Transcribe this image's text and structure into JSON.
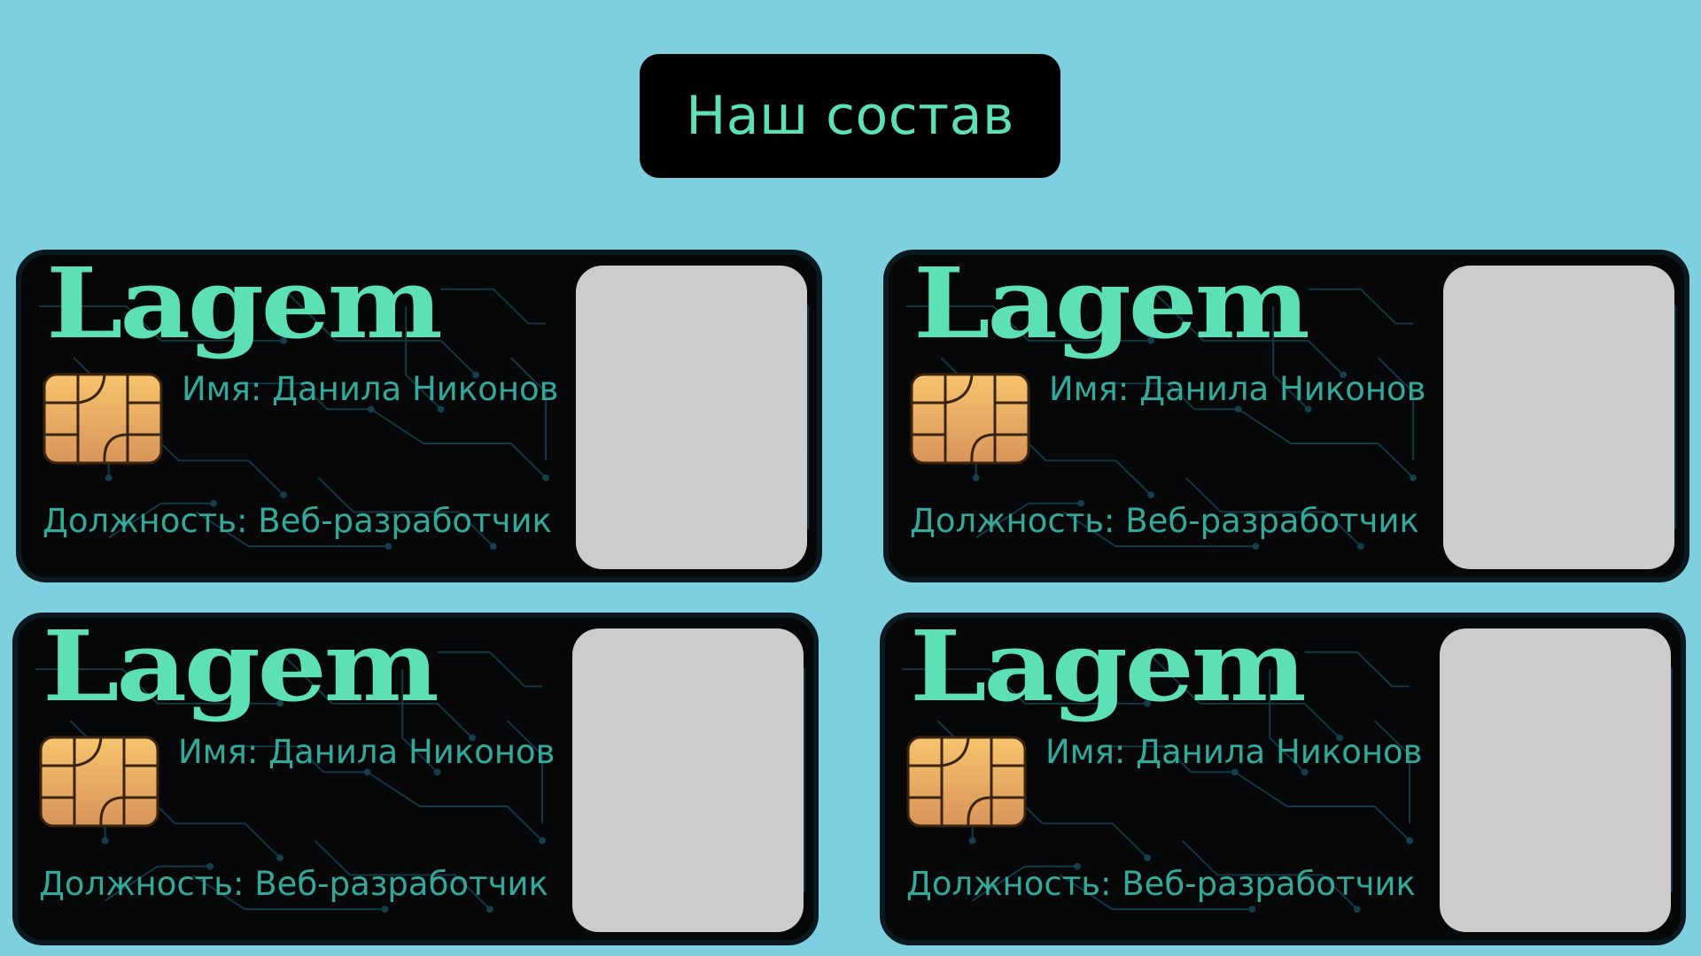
{
  "header": {
    "title": "Наш состав"
  },
  "cards": [
    {
      "logo": "Lagem",
      "chip_icon": "sim-chip-icon",
      "name": "Имя: Данила Никонов",
      "role": "Должность: Веб-разработчик"
    },
    {
      "logo": "Lagem",
      "chip_icon": "sim-chip-icon",
      "name": "Имя: Данила Никонов",
      "role": "Должность: Веб-разработчик"
    },
    {
      "logo": "Lagem",
      "chip_icon": "sim-chip-icon",
      "name": "Имя: Данила Никонов",
      "role": "Должность: Веб-разработчик"
    },
    {
      "logo": "Lagem",
      "chip_icon": "sim-chip-icon",
      "name": "Имя: Данила Никонов",
      "role": "Должность: Веб-разработчик"
    }
  ],
  "colors": {
    "background": "#7ecfdf",
    "accent": "#5de0b5",
    "text_teal": "#34a99a",
    "card": "#050708",
    "photo_placeholder": "#cccccc",
    "chip": "#e8a35e"
  }
}
